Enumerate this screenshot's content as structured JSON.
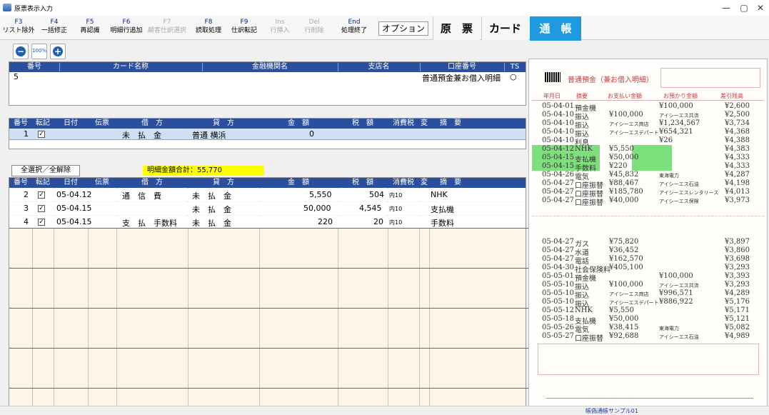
{
  "window": {
    "title": "原票表示入力",
    "min": "—",
    "max": "▢",
    "close": "✕"
  },
  "fkeys": [
    {
      "key": "F3",
      "label": "リスト除外"
    },
    {
      "key": "F4",
      "label": "一括修正"
    },
    {
      "key": "F5",
      "label": "再認識"
    },
    {
      "key": "F6",
      "label": "明細行追加"
    },
    {
      "key": "F7",
      "label": "顧客仕訳選択"
    },
    {
      "key": "F8",
      "label": "読取処理"
    },
    {
      "key": "F9",
      "label": "仕訳転記"
    },
    {
      "key": "Ins",
      "label": "行挿入"
    },
    {
      "key": "Del",
      "label": "行削除"
    },
    {
      "key": "End",
      "label": "処理終了"
    }
  ],
  "option_label": "オプション",
  "tabs": {
    "genpyo": "原　票",
    "card": "カード",
    "tsucho": "通　帳"
  },
  "zoom": {
    "level": "100%",
    "minus": "−",
    "plus": "+"
  },
  "top_table": {
    "headers": [
      "番号",
      "カード名称",
      "金融機関名",
      "支店名",
      "口座番号",
      "TS"
    ],
    "row": {
      "no": "5",
      "account": "普通預金兼お借入明細",
      "ts": "○"
    }
  },
  "mid_table": {
    "headers": [
      "番号",
      "転記",
      "日付",
      "伝票",
      "借　方",
      "貸　方",
      "金　額",
      "税　額",
      "消費税",
      "変",
      "摘　要"
    ],
    "row": {
      "no": "1",
      "debit": "未　払　金",
      "credit": "普通 横浜",
      "amount": "0"
    }
  },
  "select_all": "全選択／全解除",
  "total": "明細金額合計：55,770",
  "lower_table": {
    "headers": [
      "番号",
      "転記",
      "日付",
      "伝票",
      "借　方",
      "貸　方",
      "金　額",
      "税　額",
      "消費税",
      "変",
      "摘　要"
    ],
    "rows": [
      {
        "no": "2",
        "date": "05-04.12",
        "debit": "通　信　費",
        "credit": "未　払　金",
        "amount": "5,550",
        "tax": "504",
        "taxcode": "内10",
        "memo": "NHK"
      },
      {
        "no": "3",
        "date": "05-04.15",
        "debit": "",
        "credit": "未　払　金",
        "amount": "50,000",
        "tax": "4,545",
        "taxcode": "内10",
        "memo": "支払機"
      },
      {
        "no": "4",
        "date": "05-04.15",
        "debit": "支　払　手数料",
        "credit": "未　払　金",
        "amount": "220",
        "tax": "20",
        "taxcode": "内10",
        "memo": "手数料"
      }
    ]
  },
  "ledger": {
    "title": "普通預金（兼お借入明細）",
    "headers": [
      "年月日",
      "摘要",
      "お支払い金額",
      "お預かり金額",
      "差引残高"
    ],
    "rows1": [
      [
        "05-04-01",
        "預金機",
        "",
        "¥100,000",
        "¥2,600"
      ],
      [
        "05-04-10",
        "振込",
        "¥100,000",
        "アイシーエス共済",
        "¥2,500"
      ],
      [
        "05-04-10",
        "振込",
        "アイシーエス商店",
        "¥1,234,567",
        "¥3,734"
      ],
      [
        "05-04-10",
        "振込",
        "アイシーエスデパート",
        "¥654,321",
        "¥4,368"
      ],
      [
        "05-04-10",
        "利息",
        "",
        "¥26",
        "¥4,388"
      ],
      [
        "05-04-12",
        "NHK",
        "¥5,550",
        "",
        "¥4,383"
      ],
      [
        "05-04-15",
        "支払機",
        "¥50,000",
        "",
        "¥4,333"
      ],
      [
        "05-04-15",
        "手数料",
        "¥220",
        "",
        "¥4,333"
      ],
      [
        "05-04-26",
        "電気",
        "¥45,832",
        "東海電力",
        "¥4,287"
      ],
      [
        "05-04-27",
        "口座振替",
        "¥88,467",
        "アイシーエス石油",
        "¥4,198"
      ],
      [
        "05-04-27",
        "口座振替",
        "¥185,780",
        "アイシーエスレンタリース",
        "¥4,013"
      ],
      [
        "05-04-27",
        "口座振替",
        "¥40,000",
        "アイシーエス保険",
        "¥3,973"
      ]
    ],
    "rows2": [
      [
        "05-04-27",
        "ガス",
        "¥75,820",
        "",
        "¥3,897"
      ],
      [
        "05-04-27",
        "水道",
        "¥36,452",
        "",
        "¥3,860"
      ],
      [
        "05-04-27",
        "電話",
        "¥162,570",
        "",
        "¥3,698"
      ],
      [
        "05-04-30",
        "社会保険料",
        "¥405,100",
        "",
        "¥3,293"
      ],
      [
        "05-05-01",
        "預金機",
        "",
        "¥100,000",
        "¥3,393"
      ],
      [
        "05-05-10",
        "振込",
        "¥100,000",
        "アイシーエス共済",
        "¥3,293"
      ],
      [
        "05-05-10",
        "振込",
        "アイシーエス商店",
        "¥996,571",
        "¥4,289"
      ],
      [
        "05-05-10",
        "振込",
        "アイシーエスデパート",
        "¥886,922",
        "¥5,176"
      ],
      [
        "05-05-12",
        "NHK",
        "¥5,550",
        "",
        "¥5,171"
      ],
      [
        "05-05-18",
        "支払機",
        "¥50,000",
        "",
        "¥5,121"
      ],
      [
        "05-05-26",
        "電気",
        "¥38,415",
        "東海電力",
        "¥5,082"
      ],
      [
        "05-05-27",
        "口座振替",
        "¥92,688",
        "アイシーエス石油",
        "¥4,989"
      ]
    ],
    "footer_caption": "帳偽通帳サンプル01"
  }
}
